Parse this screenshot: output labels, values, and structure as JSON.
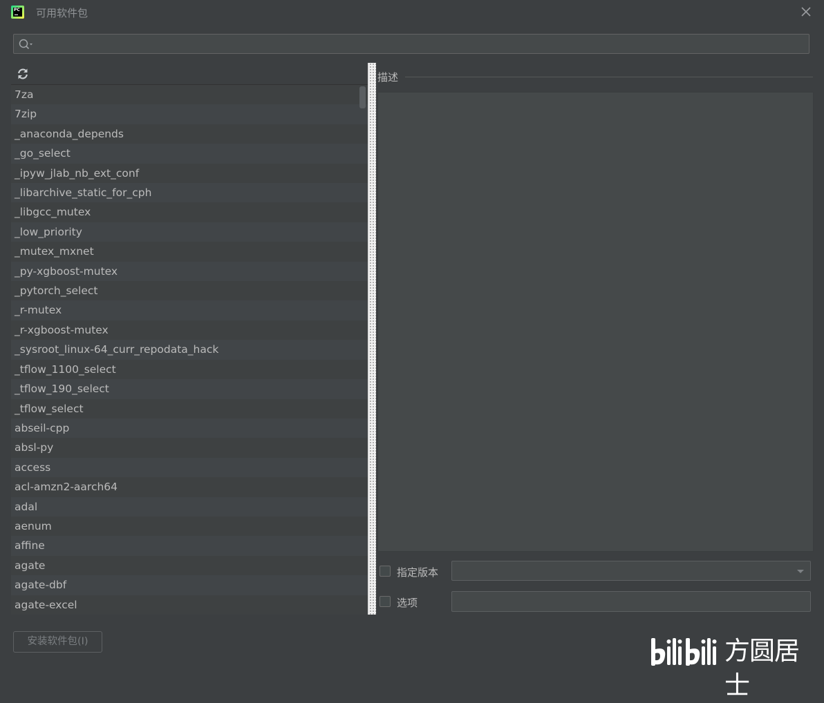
{
  "window": {
    "title": "可用软件包"
  },
  "search": {
    "placeholder": "",
    "value": ""
  },
  "packages": [
    "7za",
    "7zip",
    "_anaconda_depends",
    "_go_select",
    "_ipyw_jlab_nb_ext_conf",
    "_libarchive_static_for_cph",
    "_libgcc_mutex",
    "_low_priority",
    "_mutex_mxnet",
    "_py-xgboost-mutex",
    "_pytorch_select",
    "_r-mutex",
    "_r-xgboost-mutex",
    "_sysroot_linux-64_curr_repodata_hack",
    "_tflow_1100_select",
    "_tflow_190_select",
    "_tflow_select",
    "abseil-cpp",
    "absl-py",
    "access",
    "acl-amzn2-aarch64",
    "adal",
    "aenum",
    "affine",
    "agate",
    "agate-dbf",
    "agate-excel"
  ],
  "description": {
    "label": "描述",
    "text": ""
  },
  "options": {
    "specify_version_label": "指定版本",
    "specify_version_value": "",
    "options_label": "选项",
    "options_value": ""
  },
  "install_button": {
    "label": "安装软件包(I)"
  },
  "watermark": {
    "text": "方圆居士",
    "logo": "bilibili"
  },
  "colors": {
    "background": "#3c3f41",
    "panel": "#45494a",
    "text": "#bbbbbb",
    "accent": "#21d789"
  },
  "icons": {
    "app": "pycharm-icon",
    "search": "search-icon",
    "refresh": "refresh-icon",
    "close": "close-icon"
  }
}
